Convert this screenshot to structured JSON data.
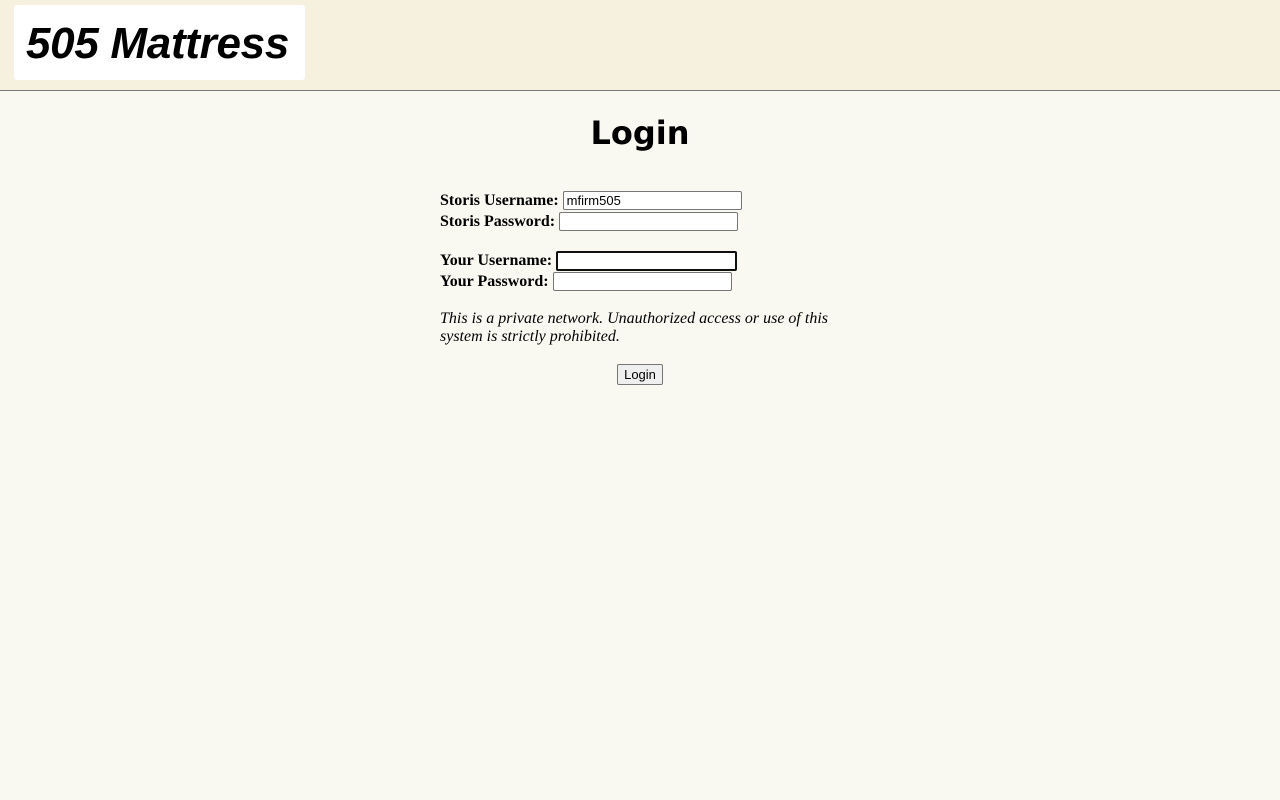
{
  "header": {
    "logo_text": "505 Mattress"
  },
  "page_title": "Login",
  "form": {
    "storis_username_label": "Storis Username:",
    "storis_username_value": "mfirm505",
    "storis_password_label": "Storis Password:",
    "storis_password_value": "",
    "your_username_label": "Your Username:",
    "your_username_value": "",
    "your_password_label": "Your Password:",
    "your_password_value": "",
    "notice": "This is a private network. Unauthorized access or use of this system is strictly prohibited.",
    "submit_label": "Login"
  }
}
